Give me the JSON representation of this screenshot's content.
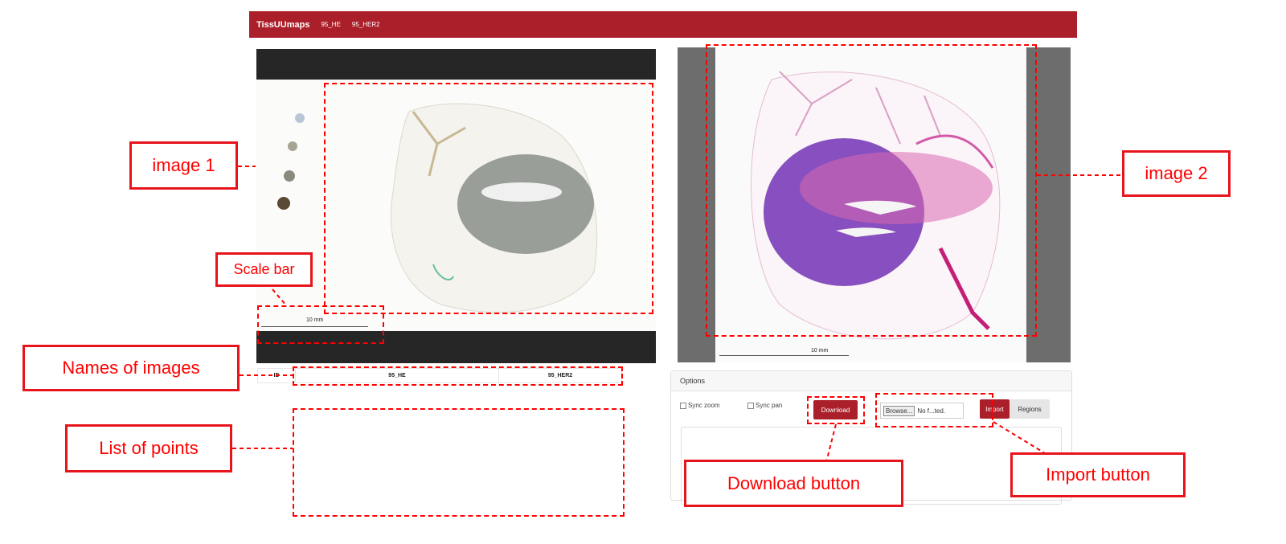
{
  "navbar": {
    "brand": "TissUUmaps",
    "links": [
      "95_HE",
      "95_HER2"
    ]
  },
  "viewer1": {
    "scale_text": "10 mm"
  },
  "viewer2": {
    "scale_text": "10 mm"
  },
  "names_table": {
    "id_header": "ID",
    "image1": "95_HE",
    "image2": "95_HER2"
  },
  "options": {
    "title": "Options",
    "sync_zoom": "Sync zoom",
    "sync_pan": "Sync pan",
    "download": "Download",
    "browse": "Browse...",
    "file_text": "No f...ted.",
    "import": "Import",
    "regions": "Regions"
  },
  "annotations": {
    "image1": "image 1",
    "image2": "image 2",
    "scale_bar": "Scale bar",
    "names_of_images": "Names of images",
    "list_of_points": "List of points",
    "download_button": "Download button",
    "import_button": "Import button"
  },
  "colors": {
    "brand": "#ab1f2a",
    "annotation": "#ff0000"
  }
}
